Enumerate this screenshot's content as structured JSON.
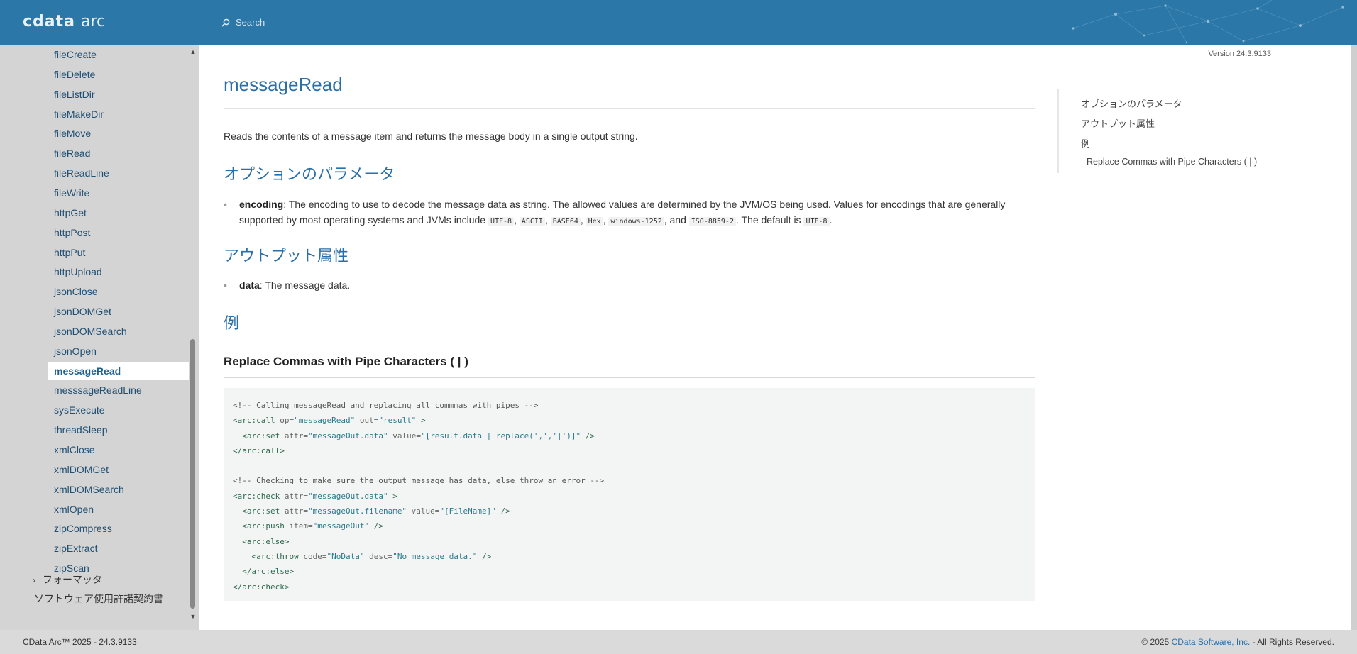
{
  "header": {
    "logo_main": "cdata",
    "logo_sub": "arc",
    "search_placeholder": "Search"
  },
  "sidebar": {
    "items": [
      {
        "label": "fileCreate"
      },
      {
        "label": "fileDelete"
      },
      {
        "label": "fileListDir"
      },
      {
        "label": "fileMakeDir"
      },
      {
        "label": "fileMove"
      },
      {
        "label": "fileRead"
      },
      {
        "label": "fileReadLine"
      },
      {
        "label": "fileWrite"
      },
      {
        "label": "httpGet"
      },
      {
        "label": "httpPost"
      },
      {
        "label": "httpPut"
      },
      {
        "label": "httpUpload"
      },
      {
        "label": "jsonClose"
      },
      {
        "label": "jsonDOMGet"
      },
      {
        "label": "jsonDOMSearch"
      },
      {
        "label": "jsonOpen"
      },
      {
        "label": "messageRead"
      },
      {
        "label": "messsageReadLine"
      },
      {
        "label": "sysExecute"
      },
      {
        "label": "threadSleep"
      },
      {
        "label": "xmlClose"
      },
      {
        "label": "xmlDOMGet"
      },
      {
        "label": "xmlDOMSearch"
      },
      {
        "label": "xmlOpen"
      },
      {
        "label": "zipCompress"
      },
      {
        "label": "zipExtract"
      },
      {
        "label": "zipScan"
      }
    ],
    "active_index": 16,
    "group_label": "フォーマッタ",
    "license_label": "ソフトウェア使用許諾契約書"
  },
  "main": {
    "version": "Version 24.3.9133",
    "title": "messageRead",
    "intro": "Reads the contents of a message item and returns the message body in a single output string.",
    "optional_params_heading": "オプションのパラメータ",
    "encoding": {
      "name": "encoding",
      "desc_a": ": The encoding to use to decode the message data as string. The allowed values are determined by the JVM/OS being used. Values for encodings that are generally supported by most operating systems and JVMs include ",
      "values": [
        "UTF-8",
        "ASCII",
        "BASE64",
        "Hex",
        "windows-1252",
        "ISO-8859-2"
      ],
      "sep": ", ",
      "and": ", and ",
      "default_text": ". The default is ",
      "default_value": "UTF-8",
      "end": "."
    },
    "output_heading": "アウトプット属性",
    "data_attr": {
      "name": "data",
      "desc": ": The message data."
    },
    "example_heading": "例",
    "example_title": "Replace Commas with Pipe Characters ( | )",
    "code_lines": [
      "<!-- Calling messageRead and replacing all commmas with pipes -->",
      "<arc:call op=\"messageRead\" out=\"result\" >",
      "  <arc:set attr=\"messageOut.data\" value=\"[result.data | replace(',','|')]\" />",
      "</arc:call>",
      "",
      "<!-- Checking to make sure the output message has data, else throw an error -->",
      "<arc:check attr=\"messageOut.data\" >",
      "  <arc:set attr=\"messageOut.filename\" value=\"[FileName]\" />",
      "  <arc:push item=\"messageOut\" />",
      "  <arc:else>",
      "    <arc:throw code=\"NoData\" desc=\"No message data.\" />",
      "  </arc:else>",
      "</arc:check>"
    ]
  },
  "toc": {
    "items": [
      {
        "label": "オプションのパラメータ"
      },
      {
        "label": "アウトプット属性"
      },
      {
        "label": "例"
      },
      {
        "label": "Replace Commas with Pipe Characters ( | )"
      }
    ]
  },
  "footer": {
    "left": "CData Arc™ 2025 - 24.3.9133",
    "right_prefix": "© 2025 ",
    "right_link": "CData Software, Inc.",
    "right_suffix": " - All Rights Reserved."
  },
  "colors": {
    "header_bg": "#2b77a8",
    "link_blue": "#2b6fa8",
    "sidebar_bg": "#d4d4d4"
  }
}
